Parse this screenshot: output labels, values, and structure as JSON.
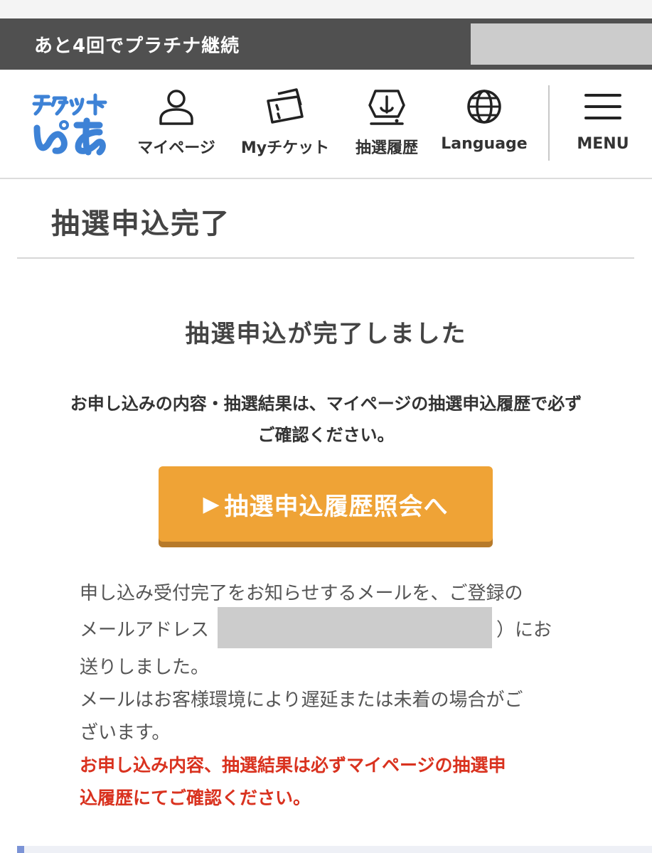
{
  "status_bar": {
    "text": "あと4回でプラチナ継続"
  },
  "header": {
    "logo_alt": "チケットぴあ",
    "nav": [
      {
        "label": "マイページ",
        "icon": "user-icon"
      },
      {
        "label": "Myチケット",
        "icon": "ticket-icon"
      },
      {
        "label": "抽選履歴",
        "icon": "lottery-icon"
      },
      {
        "label": "Language",
        "icon": "globe-icon"
      },
      {
        "label": "MENU",
        "icon": "hamburger-menu-icon"
      }
    ]
  },
  "page": {
    "title": "抽選申込完了",
    "complete_heading": "抽選申込が完了しました",
    "notice_line1": "お申し込みの内容・抽選結果は、マイページの抽選申込履歴で必ず",
    "notice_line2": "ご確認ください。",
    "cta_label": "抽選申込履歴照会へ",
    "mail_line1": "申し込み受付完了をお知らせするメールを、ご登録の",
    "mail_line2_prefix": "メールアドレス",
    "mail_line2_suffix": "）にお",
    "mail_line3": "送りしました。",
    "mail_line4": "メールはお客様環境により遅延または未着の場合がご",
    "mail_line5": "ざいます。",
    "warning_line1": "お申し込み内容、抽選結果は必ずマイページの抽選申",
    "warning_line2": "込履歴にてご確認ください。"
  },
  "colors": {
    "accent_orange": "#efa336",
    "warning_red": "#d9321f",
    "status_bar_bg": "#505050",
    "logo_blue": "#3d82d6"
  }
}
